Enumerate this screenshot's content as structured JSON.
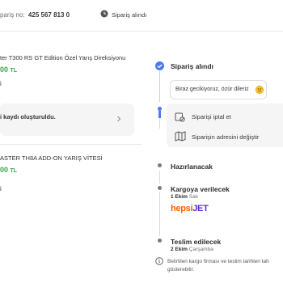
{
  "header": {
    "order_no_label": "pariş no:",
    "order_no_value": "425 567 813 0",
    "status_label": "Sipariş alındı"
  },
  "products": [
    {
      "name": "ter T300 RS GT Edition Özel Yarış Direksiyonu",
      "price_value": "00",
      "price_currency": "TL"
    },
    {
      "name": "ASTER TH8A ADD-ON YARIŞ VİTESİ",
      "price_value": "00",
      "price_currency": "TL"
    }
  ],
  "left_texts": {
    "item1_tail": "i",
    "record_notice": "i kaydı oluşturuldu.",
    "item2_tail": "i"
  },
  "timeline": {
    "step_received": "Sipariş alındı",
    "delay_message": "Biraz gecikiyoruz, özür dileriz",
    "cancel_action": "Siparişi iptal et",
    "change_address_action": "Siparişin adresini değiştir",
    "step_preparing": "Hazırlanacak",
    "step_shipping": "Kargoya verilecek",
    "shipping_date": "1 Ekim",
    "shipping_day": "Salı",
    "carrier_logo_hepsi": "hepsi",
    "carrier_logo_jet": "JET",
    "step_delivery": "Teslim edilecek",
    "delivery_date": "2 Ekim",
    "delivery_day": "Çarşamba",
    "note_line1": "Belirtilen kargo firması ve teslim tarihleri tah",
    "note_line2": "gösterebilir."
  },
  "colors": {
    "accent_blue": "#4a7cf0",
    "price_green": "#3aa545",
    "brand_orange": "#ff6000",
    "brand_purple": "#5a2bd6"
  }
}
